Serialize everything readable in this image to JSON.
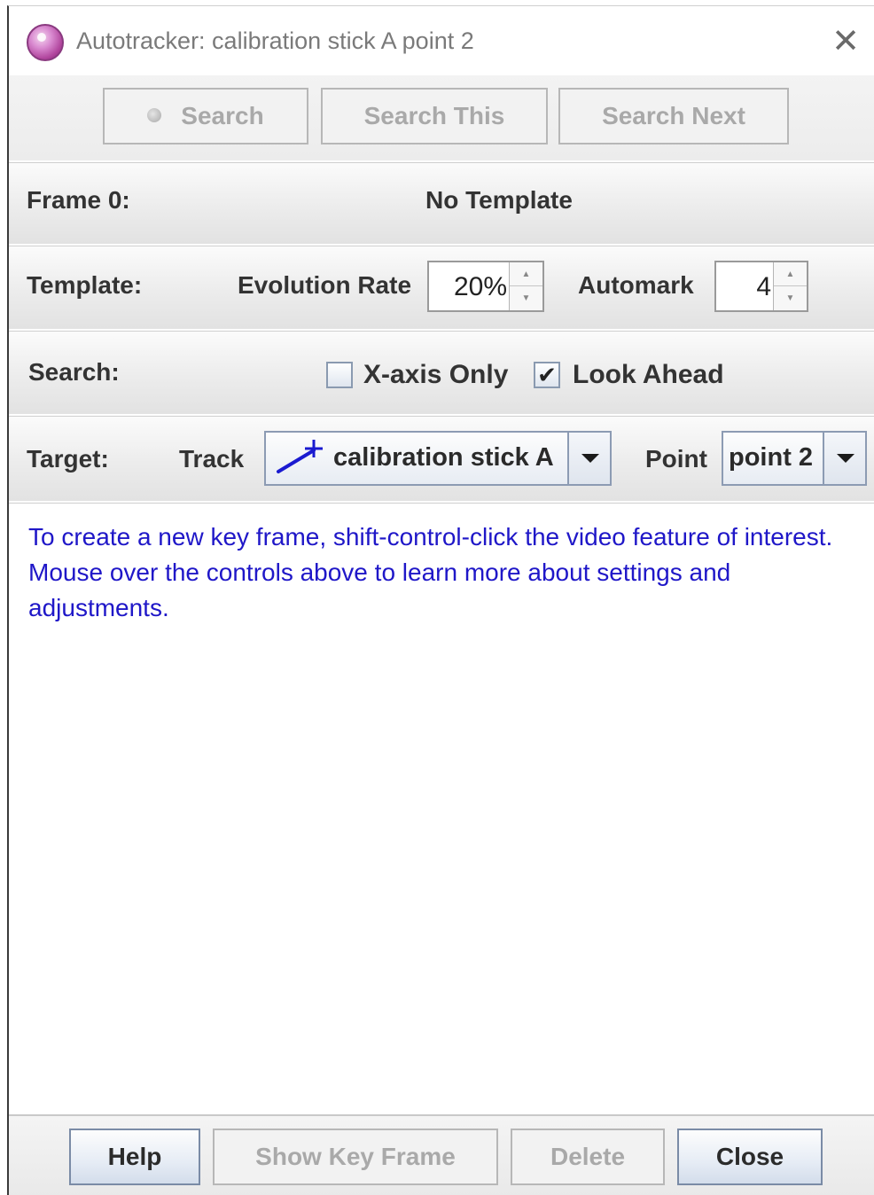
{
  "window": {
    "title": "Autotracker: calibration stick A point 2",
    "close_glyph": "✕"
  },
  "search_buttons": {
    "search": "Search",
    "search_this": "Search This",
    "search_next": "Search Next"
  },
  "frame_row": {
    "label": "Frame 0:",
    "status": "No Template"
  },
  "template_row": {
    "label": "Template:",
    "evolution_rate_label": "Evolution Rate",
    "evolution_rate_value": "20%",
    "automark_label": "Automark",
    "automark_value": "4"
  },
  "search_row": {
    "label": "Search:",
    "x_axis_only_label": "X-axis Only",
    "x_axis_only_checked": false,
    "look_ahead_label": "Look Ahead",
    "look_ahead_checked": true
  },
  "target_row": {
    "label": "Target:",
    "track_label": "Track",
    "track_value": "calibration stick A",
    "point_label": "Point",
    "point_value": "point 2"
  },
  "message": "To create a new key frame, shift-control-click the video feature of interest. Mouse over the controls above to learn more about settings and adjustments.",
  "bottom_buttons": {
    "help": "Help",
    "show_key_frame": "Show Key Frame",
    "delete": "Delete",
    "close": "Close"
  },
  "colors": {
    "message_text": "#1f17c8",
    "track_icon": "#1a1ad0",
    "disabled_text": "#a9a9a9"
  },
  "icons": {
    "app": "autotracker-app-icon",
    "search": "search-dot-icon",
    "track": "calibration-stick-icon",
    "dropdown": "chevron-down-icon"
  }
}
